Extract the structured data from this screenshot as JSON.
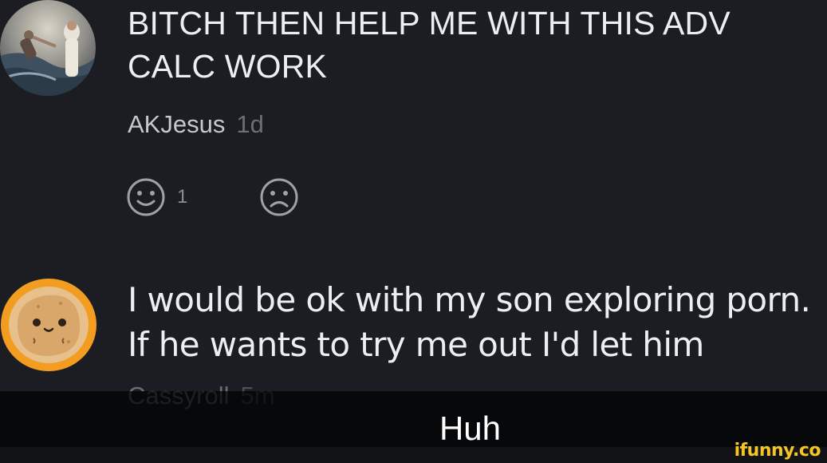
{
  "comments": [
    {
      "text_lines": [
        "BITCH THEN HELP ME WITH THIS ADV",
        "CALC WORK"
      ],
      "username": "AKJesus",
      "age": "1d",
      "avatar_icon": "painting-avatar",
      "like_count": "1"
    },
    {
      "text_lines": [
        "I would be ok with my son exploring porn.",
        "If he wants to try me out I'd let him"
      ],
      "username": "Cassyroll",
      "age": "5m",
      "avatar_icon": "potato-cartoon-avatar"
    }
  ],
  "caption": "Huh",
  "watermark": "ifunny.co",
  "colors": {
    "background": "#1c1d22",
    "text": "#eceff2",
    "avatar2_ring": "#f29d1f",
    "watermark": "#f5c623"
  }
}
